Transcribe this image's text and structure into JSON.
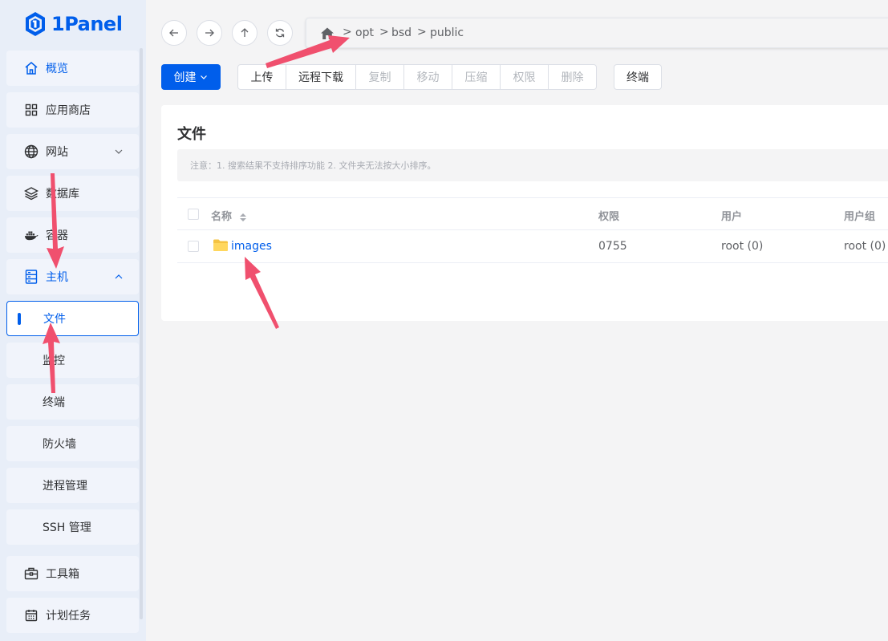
{
  "app": {
    "logo_text": "1Panel",
    "brand_color": "#005eeb"
  },
  "sidebar": {
    "items": [
      {
        "key": "overview",
        "label": "概览",
        "icon": "home-icon",
        "active": true
      },
      {
        "key": "appstore",
        "label": "应用商店",
        "icon": "apps-grid-icon"
      },
      {
        "key": "website",
        "label": "网站",
        "icon": "globe-icon",
        "expandable": "collapsed"
      },
      {
        "key": "database",
        "label": "数据库",
        "icon": "layers-icon"
      },
      {
        "key": "container",
        "label": "容器",
        "icon": "docker-icon"
      },
      {
        "key": "host",
        "label": "主机",
        "icon": "server-icon",
        "expandable": "expanded",
        "active": true
      },
      {
        "key": "toolbox",
        "label": "工具箱",
        "icon": "toolbox-icon"
      },
      {
        "key": "cronjob",
        "label": "计划任务",
        "icon": "calendar-icon"
      }
    ],
    "host_children": [
      {
        "key": "files",
        "label": "文件",
        "selected": true
      },
      {
        "key": "monitor",
        "label": "监控"
      },
      {
        "key": "terminal",
        "label": "终端"
      },
      {
        "key": "firewall",
        "label": "防火墙"
      },
      {
        "key": "process",
        "label": "进程管理"
      },
      {
        "key": "ssh",
        "label": "SSH 管理"
      }
    ]
  },
  "navigation": {
    "back_icon": "arrow-left-icon",
    "forward_icon": "arrow-right-icon",
    "up_icon": "arrow-up-icon",
    "refresh_icon": "refresh-icon",
    "path_separator": ">",
    "path": [
      "opt",
      "bsd",
      "public"
    ]
  },
  "toolbar": {
    "create_label": "创建",
    "actions": [
      {
        "label": "上传",
        "enabled": true
      },
      {
        "label": "远程下载",
        "enabled": true
      },
      {
        "label": "复制",
        "enabled": false
      },
      {
        "label": "移动",
        "enabled": false
      },
      {
        "label": "压缩",
        "enabled": false
      },
      {
        "label": "权限",
        "enabled": false
      },
      {
        "label": "删除",
        "enabled": false
      }
    ],
    "terminal_label": "终端"
  },
  "files": {
    "title": "文件",
    "notice": "注意：1. 搜索结果不支持排序功能 2. 文件夹无法按大小排序。",
    "columns": {
      "name": "名称",
      "permission": "权限",
      "user": "用户",
      "group": "用户组"
    },
    "rows": [
      {
        "name": "images",
        "type": "folder",
        "permission": "0755",
        "user": "root (0)",
        "group": "root (0)"
      }
    ]
  },
  "annotation_color": "#f0506e"
}
